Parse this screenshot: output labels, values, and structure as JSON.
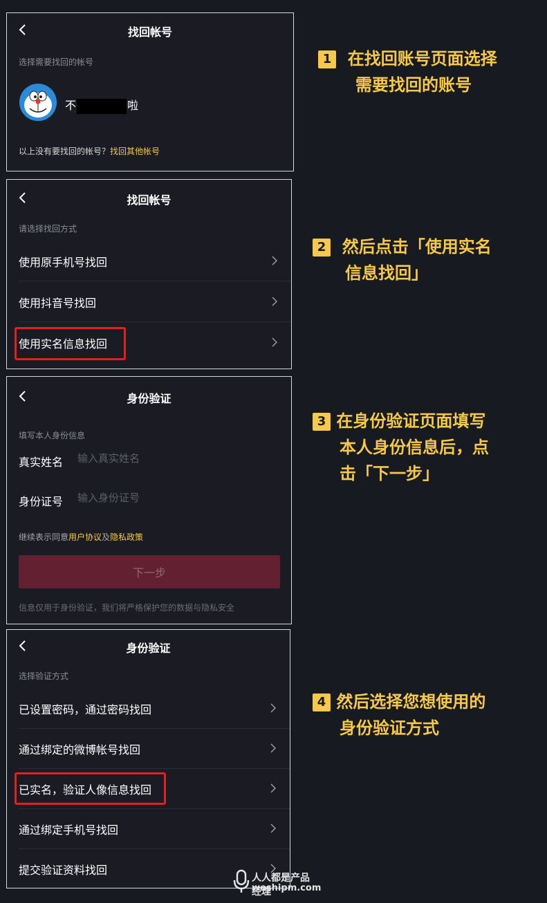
{
  "panel1": {
    "title": "找回帐号",
    "hint": "选择需要找回的帐号",
    "account_prefix": "不",
    "account_suffix": "啦",
    "footer_text": "以上没有要找回的帐号？",
    "footer_link": "找回其他帐号"
  },
  "panel2": {
    "title": "找回帐号",
    "hint": "请选择找回方式",
    "options": [
      {
        "label": "使用原手机号找回"
      },
      {
        "label": "使用抖音号找回"
      },
      {
        "label": "使用实名信息找回"
      }
    ]
  },
  "panel3": {
    "title": "身份验证",
    "hint": "填写本人身份信息",
    "name_label": "真实姓名",
    "name_placeholder": "输入真实姓名",
    "id_label": "身份证号",
    "id_placeholder": "输入身份证号",
    "agree_prefix": "继续表示同意",
    "agree_link1": "用户协议",
    "agree_and": "及",
    "agree_link2": "隐私政策",
    "next_button": "下一步",
    "privacy_note": "信息仅用于身份验证，我们将严格保护您的数据与隐私安全"
  },
  "panel4": {
    "title": "身份验证",
    "hint": "选择验证方式",
    "options": [
      {
        "label": "已设置密码，通过密码找回"
      },
      {
        "label": "通过绑定的微博帐号找回"
      },
      {
        "label": "已实名，验证人像信息找回"
      },
      {
        "label": "通过绑定手机号找回"
      },
      {
        "label": "提交验证资料找回"
      }
    ]
  },
  "steps": [
    {
      "num": "1",
      "line1": "在找回账号页面选择",
      "line2": "需要找回的账号"
    },
    {
      "num": "2",
      "line1": "然后点击「使用实名",
      "line2": "信息找回」"
    },
    {
      "num": "3",
      "line1": "在身份验证页面填写",
      "line2": "本人身份信息后，点",
      "line3": "击「下一步」"
    },
    {
      "num": "4",
      "line1": "然后选择您想使用的",
      "line2": "身份验证方式"
    }
  ],
  "watermark": {
    "cn": "人人都是产品经理",
    "en": "woshipm.com"
  },
  "colors": {
    "accent_gold": "#f6c94c",
    "highlight_red": "#e3201f",
    "button_disabled": "#632031"
  }
}
